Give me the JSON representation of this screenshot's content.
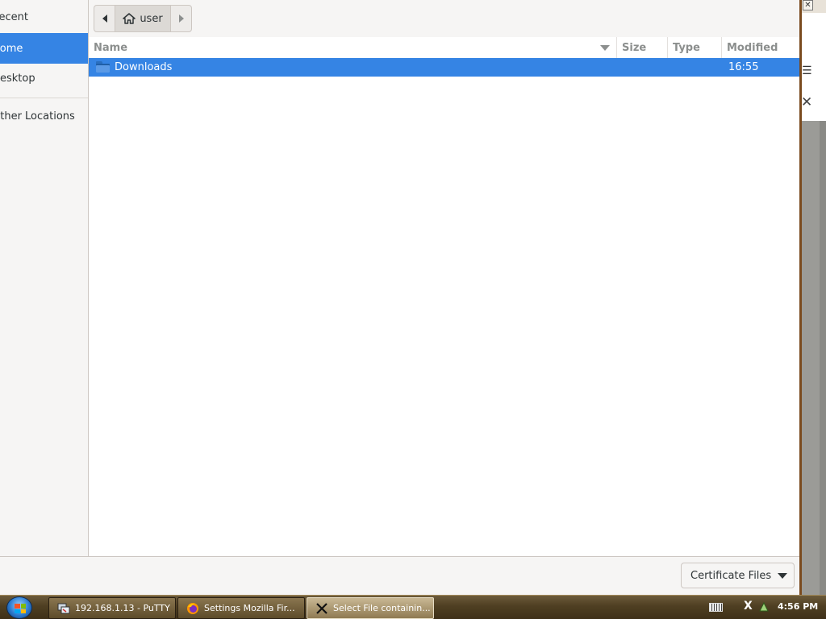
{
  "dialog": {
    "sidebar": {
      "items": [
        {
          "label": "Recent"
        },
        {
          "label": "Home"
        },
        {
          "label": "Desktop"
        },
        {
          "label": "Other Locations"
        }
      ]
    },
    "pathbar": {
      "current": "user",
      "home_icon": "home-icon"
    },
    "filelist": {
      "columns": [
        "Name",
        "Size",
        "Type",
        "Modified"
      ],
      "rows": [
        {
          "name": "Downloads",
          "size": "",
          "type": "",
          "modified": "16:55",
          "icon": "folder-icon"
        }
      ]
    },
    "filter": {
      "label": "Certificate Files"
    }
  },
  "taskbar": {
    "tasks": [
      {
        "label": "192.168.1.13 - PuTTY",
        "icon": "putty-icon"
      },
      {
        "label": "Settings  Mozilla Fir...",
        "icon": "firefox-icon"
      },
      {
        "label": "Select File containin...",
        "icon": "x-icon"
      }
    ],
    "clock": "4:56 PM"
  },
  "colors": {
    "selection": "#3584e4",
    "taskbar": "#4f3f22"
  }
}
